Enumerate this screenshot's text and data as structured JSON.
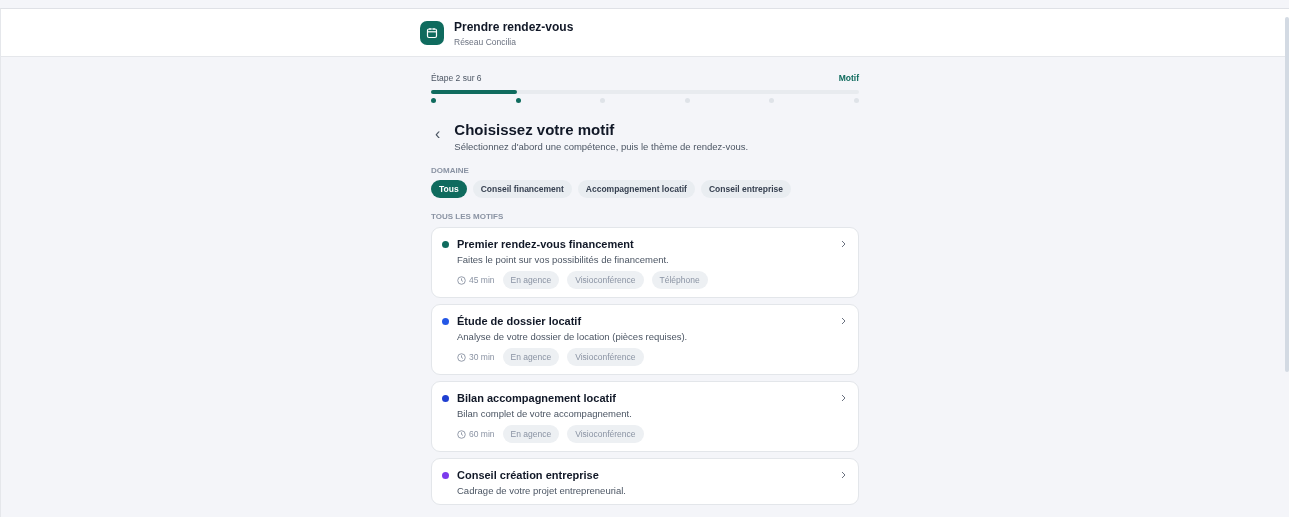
{
  "header": {
    "title": "Prendre rendez-vous",
    "subtitle": "Réseau Concilia"
  },
  "progress": {
    "step_label": "Étape 2 sur 6",
    "step_name": "Motif",
    "level": 0.2,
    "steps": [
      {
        "done": true
      },
      {
        "done": true
      },
      {
        "done": false
      },
      {
        "done": false
      },
      {
        "done": false
      },
      {
        "done": false
      }
    ]
  },
  "heading": {
    "back": "‹",
    "title": "Choisissez votre motif",
    "subtitle": "Sélectionnez d'abord une compétence, puis le thème de rendez-vous."
  },
  "domain": {
    "label": "DOMAINE",
    "filters": [
      {
        "label": "Tous",
        "selected": true
      },
      {
        "label": "Conseil financement",
        "selected": false
      },
      {
        "label": "Accompagnement locatif",
        "selected": false
      },
      {
        "label": "Conseil entreprise",
        "selected": false
      }
    ]
  },
  "list_label": "TOUS LES MOTIFS",
  "motifs": [
    {
      "title": "Premier rendez-vous financement",
      "description": "Faites le point sur vos possibilités de financement.",
      "color": "#0f6b5e",
      "duration": "45 min",
      "modes": [
        "En agence",
        "Visioconférence",
        "Téléphone"
      ]
    },
    {
      "title": "Étude de dossier locatif",
      "description": "Analyse de votre dossier de location (pièces requises).",
      "color": "#2457e6",
      "duration": "30 min",
      "modes": [
        "En agence",
        "Visioconférence"
      ]
    },
    {
      "title": "Bilan accompagnement locatif",
      "description": "Bilan complet de votre accompagnement.",
      "color": "#1f3fd1",
      "duration": "60 min",
      "modes": [
        "En agence",
        "Visioconférence"
      ]
    },
    {
      "title": "Conseil création entreprise",
      "description": "Cadrage de votre projet entrepreneurial.",
      "color": "#7c3aed"
    }
  ]
}
